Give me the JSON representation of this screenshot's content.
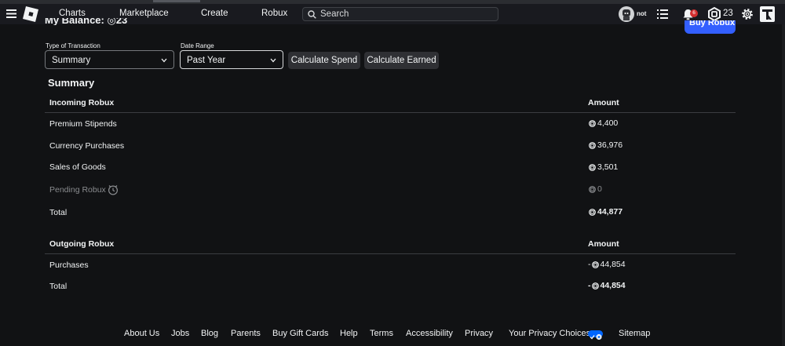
{
  "navbar": {
    "links": [
      "Charts",
      "Marketplace",
      "Create",
      "Robux"
    ],
    "search_placeholder": "Search",
    "username": "not",
    "notification_count": "6",
    "robux_balance": "23"
  },
  "header": {
    "title": "My Balance: ◎23",
    "buy_robux_label": "Buy Robux"
  },
  "filters": {
    "transaction_type_label": "Type of Transaction",
    "transaction_type_value": "Summary",
    "date_range_label": "Date Range",
    "date_range_value": "Past Year",
    "calculate_spend_label": "Calculate Spend",
    "calculate_earned_label": "Calculate Earned"
  },
  "summary": {
    "title": "Summary",
    "incoming": {
      "header_label": "Incoming Robux",
      "amount_header": "Amount",
      "rows": [
        {
          "label": "Premium Stipends",
          "amount": "4,400"
        },
        {
          "label": "Currency Purchases",
          "amount": "36,976"
        },
        {
          "label": "Sales of Goods",
          "amount": "3,501"
        },
        {
          "label": "Pending Robux",
          "amount": "0"
        }
      ],
      "total_label": "Total",
      "total_amount": "44,877"
    },
    "outgoing": {
      "header_label": "Outgoing Robux",
      "amount_header": "Amount",
      "rows": [
        {
          "label": "Purchases",
          "amount": "44,854"
        }
      ],
      "total_label": "Total",
      "total_amount": "44,854",
      "negative_sign": "-"
    }
  },
  "footer": {
    "links": [
      "About Us",
      "Jobs",
      "Blog",
      "Parents",
      "Buy Gift Cards",
      "Help",
      "Terms",
      "Accessibility",
      "Privacy",
      "Your Privacy Choices",
      "Sitemap"
    ]
  },
  "colors": {
    "background": "#111214",
    "navbar": "#191a1f",
    "accent": "#335fff",
    "badge": "#d32f2f",
    "muted_text": "#8a8c8f"
  }
}
